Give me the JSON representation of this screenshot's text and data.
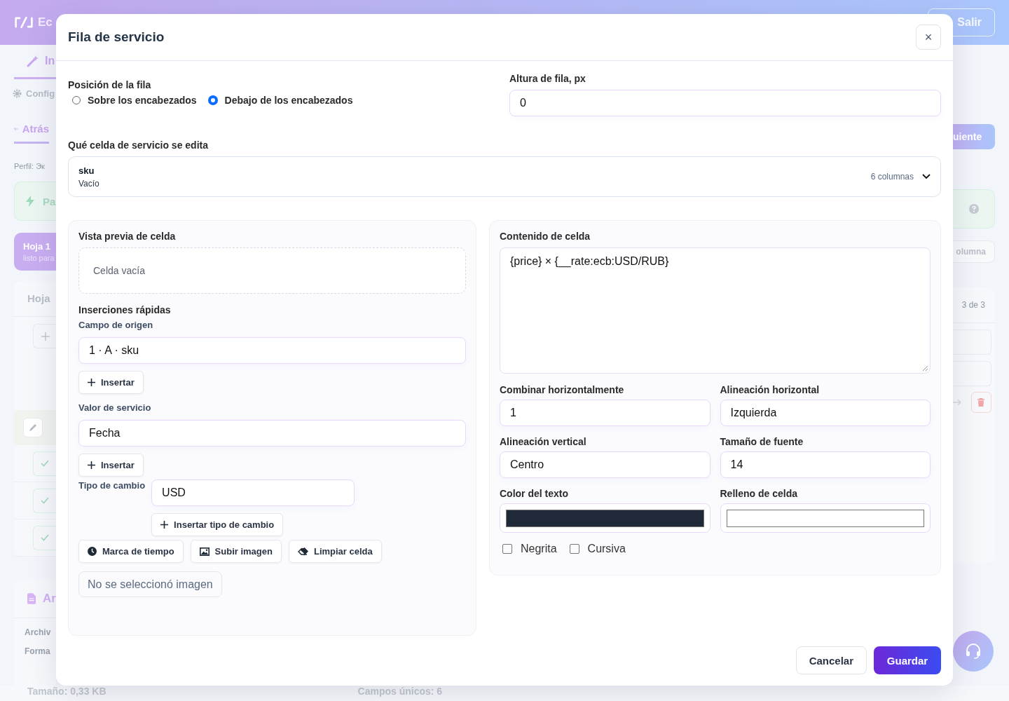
{
  "background": {
    "logo_text": "Ec",
    "tab": "In",
    "config": "Config",
    "back": "Atrás",
    "profile": "Perfil: Эк",
    "panel": "Pa",
    "sheet_card": {
      "title": "Hoja 1",
      "subtitle": "listo para"
    },
    "sheet_heading": "Hoja",
    "file_title": "Ar",
    "file_rows": [
      "Archiv",
      "Forma"
    ],
    "size": "Tamaño: 0,33 KB",
    "unique_fields": "Campos únicos: 6",
    "logout": "Salir",
    "next": "uiente",
    "add_column": "olumna",
    "pager": "3 de 3"
  },
  "dialog": {
    "title": "Fila de servicio",
    "close": "×",
    "row_position": {
      "label": "Posición de la fila",
      "options": [
        {
          "label": "Sobre los encabezados",
          "selected": false
        },
        {
          "label": "Debajo de los encabezados",
          "selected": true
        }
      ]
    },
    "row_height": {
      "label": "Altura de fila, px",
      "value": "0"
    },
    "cell_select": {
      "label": "Qué celda de servicio se edita",
      "name": "sku",
      "value": "Vacío",
      "count": "6 columnas"
    },
    "preview": {
      "title": "Vista previa de celda",
      "empty_text": "Celda vacía"
    },
    "quick_inserts": {
      "title": "Inserciones rápidas",
      "source_field": {
        "label": "Campo de origen",
        "value": "1 · A · sku",
        "button": "Insertar"
      },
      "service_value": {
        "label": "Valor de servicio",
        "value": "Fecha",
        "button": "Insertar"
      },
      "exchange_rate": {
        "label": "Tipo de cambio",
        "value": "USD",
        "button": "Insertar tipo de cambio"
      },
      "actions": [
        {
          "kind": "timestamp",
          "label": "Marca de tiempo"
        },
        {
          "kind": "image",
          "label": "Subir imagen"
        },
        {
          "kind": "clear",
          "label": "Limpiar celda"
        }
      ],
      "image_status": "No se seleccionó imagen"
    },
    "content": {
      "label": "Contenido de celda",
      "value": "{price} × {__rate:ecb:USD/RUB}"
    },
    "fields": [
      {
        "kind": "text",
        "label": "Combinar horizontalmente",
        "value": "1"
      },
      {
        "kind": "text",
        "label": "Alineación horizontal",
        "value": "Izquierda"
      },
      {
        "kind": "text",
        "label": "Alineación vertical",
        "value": "Centro"
      },
      {
        "kind": "text",
        "label": "Tamaño de fuente",
        "value": "14"
      },
      {
        "kind": "color",
        "label": "Color del texto",
        "color": "#1f2937"
      },
      {
        "kind": "color",
        "label": "Relleno de celda",
        "color": "#ffffff"
      }
    ],
    "checkboxes": [
      {
        "label": "Negrita",
        "checked": false
      },
      {
        "label": "Cursiva",
        "checked": false
      }
    ],
    "buttons": [
      {
        "kind": "secondary",
        "label": "Cancelar"
      },
      {
        "kind": "primary",
        "label": "Guardar"
      }
    ]
  }
}
